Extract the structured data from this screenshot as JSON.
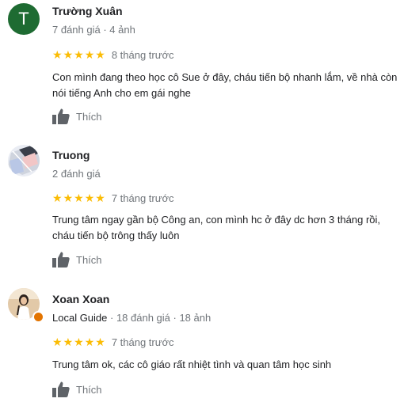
{
  "reviews": [
    {
      "avatar_letter": "T",
      "name": "Trường Xuân",
      "meta": "7 đánh giá · 4 ảnh",
      "stars": 5,
      "time": "8 tháng trước",
      "text_lines": [
        "Con mình đang theo học cô Sue ở đây, cháu tiến bộ nhanh lắm, về nhà còn",
        "nói tiếng Anh cho em gái nghe"
      ],
      "like_label": "Thích"
    },
    {
      "name": "Truong",
      "meta": "2 đánh giá",
      "stars": 5,
      "time": "7 tháng trước",
      "text_lines": [
        "Trung tâm ngay gần bộ Công an, con mình hc ở đây dc hơn 3 tháng rồi,",
        "cháu tiến bộ trông thấy luôn"
      ],
      "like_label": "Thích"
    },
    {
      "name": "Xoan Xoan",
      "meta_guide": "Local Guide",
      "meta": " · 18 đánh giá · 18 ảnh",
      "stars": 5,
      "time": "7 tháng trước",
      "text_lines": [
        "Trung tâm ok, các cô giáo rất nhiệt tình và quan tâm học sinh"
      ],
      "like_label": "Thích"
    }
  ],
  "colors": {
    "star": "#fbbc04",
    "avatar_green": "#1e6b32",
    "secondary_text": "#70757a",
    "local_guide_badge": "#e37400"
  }
}
